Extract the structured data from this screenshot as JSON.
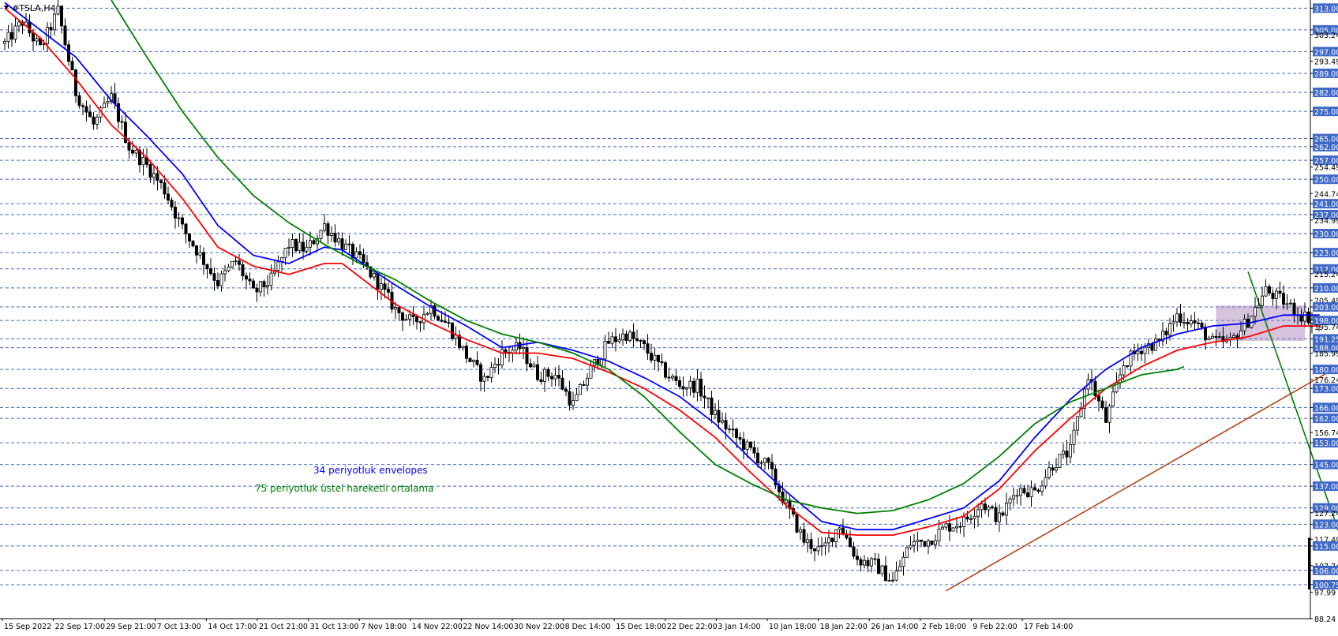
{
  "chart_data": {
    "type": "candlestick",
    "symbol_label": "#TSLA,H4",
    "price_axis": {
      "ylim": [
        88.24,
        316.0
      ],
      "tick_labels": [
        "313.00",
        "305.00",
        "303.24",
        "297.00",
        "293.49",
        "289.00",
        "282.00",
        "275.00",
        "265.00",
        "262.00",
        "257.00",
        "254.49",
        "250.00",
        "244.74",
        "241.00",
        "237.00",
        "234.99",
        "230.00",
        "223.00",
        "217.00",
        "215.24",
        "210.00",
        "205.49",
        "203.00",
        "198.00",
        "195.74",
        "191.25",
        "188.00",
        "185.99",
        "180.00",
        "176.24",
        "173.00",
        "166.00",
        "162.00",
        "156.74",
        "153.00",
        "145.00",
        "137.00",
        "129.00",
        "127.24",
        "123.00",
        "117.49",
        "115.00",
        "107.74",
        "106.00",
        "100.75",
        "97.99",
        "88.24"
      ],
      "level_lines": [
        313,
        305,
        297,
        289,
        282,
        275,
        265,
        262,
        257,
        250,
        241,
        237,
        230,
        223,
        217,
        210,
        203,
        198,
        191.25,
        188,
        180,
        173,
        166,
        162,
        153,
        145,
        137,
        129,
        123,
        115,
        106,
        100.75
      ],
      "highlighted_labels": [
        "313.00",
        "305.00",
        "297.00",
        "289.00",
        "282.00",
        "275.00",
        "265.00",
        "262.00",
        "257.00",
        "250.00",
        "241.00",
        "237.00",
        "230.00",
        "223.00",
        "217.00",
        "210.00",
        "203.00",
        "198.00",
        "191.25",
        "188.00",
        "180.00",
        "173.00",
        "166.00",
        "162.00",
        "153.00",
        "145.00",
        "137.00",
        "129.00",
        "123.00",
        "115.00",
        "106.00",
        "100.75"
      ],
      "label_color": "#4169c8"
    },
    "time_axis": {
      "labels": [
        "15 Sep 2022",
        "22 Sep 17:00",
        "29 Sep 21:00",
        "7 Oct 13:00",
        "14 Oct 17:00",
        "21 Oct 21:00",
        "31 Oct 13:00",
        "7 Nov 18:00",
        "14 Nov 22:00",
        "22 Nov 14:00",
        "30 Nov 22:00",
        "8 Dec 14:00",
        "15 Dec 18:00",
        "22 Dec 22:00",
        "3 Jan 14:00",
        "10 Jan 18:00",
        "18 Jan 22:00",
        "26 Jan 14:00",
        "2 Feb 18:00",
        "9 Feb 22:00",
        "17 Feb 14:00"
      ]
    },
    "price_path": [
      [
        0,
        300
      ],
      [
        5,
        308
      ],
      [
        10,
        298
      ],
      [
        15,
        312
      ],
      [
        20,
        282
      ],
      [
        25,
        270
      ],
      [
        30,
        280
      ],
      [
        35,
        262
      ],
      [
        40,
        255
      ],
      [
        45,
        246
      ],
      [
        50,
        232
      ],
      [
        55,
        222
      ],
      [
        60,
        212
      ],
      [
        65,
        220
      ],
      [
        70,
        208
      ],
      [
        75,
        213
      ],
      [
        80,
        226
      ],
      [
        85,
        224
      ],
      [
        90,
        233
      ],
      [
        95,
        226
      ],
      [
        100,
        220
      ],
      [
        105,
        212
      ],
      [
        110,
        202
      ],
      [
        115,
        197
      ],
      [
        120,
        203
      ],
      [
        125,
        196
      ],
      [
        130,
        185
      ],
      [
        135,
        176
      ],
      [
        140,
        186
      ],
      [
        145,
        188
      ],
      [
        150,
        178
      ],
      [
        155,
        178
      ],
      [
        160,
        167
      ],
      [
        165,
        180
      ],
      [
        170,
        190
      ],
      [
        175,
        193
      ],
      [
        180,
        188
      ],
      [
        185,
        180
      ],
      [
        190,
        174
      ],
      [
        195,
        174
      ],
      [
        200,
        163
      ],
      [
        205,
        156
      ],
      [
        210,
        150
      ],
      [
        215,
        144
      ],
      [
        220,
        130
      ],
      [
        225,
        117
      ],
      [
        230,
        113
      ],
      [
        235,
        123
      ],
      [
        240,
        110
      ],
      [
        245,
        108
      ],
      [
        250,
        102
      ],
      [
        255,
        116
      ],
      [
        260,
        117
      ],
      [
        265,
        122
      ],
      [
        270,
        124
      ],
      [
        275,
        131
      ],
      [
        280,
        125
      ],
      [
        285,
        136
      ],
      [
        290,
        135
      ],
      [
        295,
        145
      ],
      [
        300,
        150
      ],
      [
        305,
        178
      ],
      [
        310,
        161
      ],
      [
        315,
        182
      ],
      [
        320,
        188
      ],
      [
        325,
        190
      ],
      [
        330,
        200
      ],
      [
        335,
        197
      ],
      [
        340,
        190
      ],
      [
        345,
        190
      ],
      [
        350,
        198
      ],
      [
        355,
        209
      ],
      [
        360,
        205
      ],
      [
        365,
        200
      ],
      [
        370,
        198
      ]
    ],
    "series": [
      {
        "name": "34 periyotluk envelopes",
        "color": "#0000ff",
        "values": [
          [
            0,
            315
          ],
          [
            10,
            305
          ],
          [
            20,
            295
          ],
          [
            30,
            279
          ],
          [
            40,
            266
          ],
          [
            50,
            252
          ],
          [
            60,
            233
          ],
          [
            70,
            222
          ],
          [
            80,
            219
          ],
          [
            90,
            225
          ],
          [
            95,
            224
          ],
          [
            110,
            211
          ],
          [
            120,
            203
          ],
          [
            130,
            196
          ],
          [
            140,
            188
          ],
          [
            150,
            190
          ],
          [
            160,
            187
          ],
          [
            170,
            183
          ],
          [
            180,
            177
          ],
          [
            190,
            170
          ],
          [
            200,
            160
          ],
          [
            210,
            147
          ],
          [
            220,
            135
          ],
          [
            230,
            124
          ],
          [
            240,
            121
          ],
          [
            250,
            121
          ],
          [
            260,
            125
          ],
          [
            270,
            129
          ],
          [
            280,
            139
          ],
          [
            290,
            155
          ],
          [
            300,
            169
          ],
          [
            310,
            180
          ],
          [
            320,
            188
          ],
          [
            330,
            193
          ],
          [
            340,
            196
          ],
          [
            350,
            197
          ],
          [
            360,
            200
          ],
          [
            370,
            200
          ]
        ]
      },
      {
        "name": "34 periyotluk envelopes (lower)",
        "color": "#ff0000",
        "values": [
          [
            0,
            313
          ],
          [
            10,
            302
          ],
          [
            20,
            287
          ],
          [
            30,
            270
          ],
          [
            40,
            258
          ],
          [
            50,
            243
          ],
          [
            60,
            225
          ],
          [
            70,
            218
          ],
          [
            80,
            215
          ],
          [
            90,
            219
          ],
          [
            95,
            219
          ],
          [
            110,
            204
          ],
          [
            120,
            197
          ],
          [
            130,
            191
          ],
          [
            140,
            186
          ],
          [
            150,
            186
          ],
          [
            160,
            184
          ],
          [
            170,
            179
          ],
          [
            180,
            173
          ],
          [
            190,
            165
          ],
          [
            200,
            155
          ],
          [
            210,
            142
          ],
          [
            220,
            130
          ],
          [
            230,
            120
          ],
          [
            240,
            119
          ],
          [
            250,
            119
          ],
          [
            260,
            122
          ],
          [
            270,
            126
          ],
          [
            280,
            136
          ],
          [
            290,
            150
          ],
          [
            300,
            162
          ],
          [
            310,
            173
          ],
          [
            320,
            181
          ],
          [
            330,
            187
          ],
          [
            340,
            190
          ],
          [
            350,
            192
          ],
          [
            360,
            196
          ],
          [
            370,
            196
          ]
        ]
      },
      {
        "name": "75 periyotluk üstel hareketli ortalama",
        "color": "#008000",
        "values": [
          [
            30,
            316
          ],
          [
            40,
            295
          ],
          [
            50,
            275
          ],
          [
            60,
            258
          ],
          [
            70,
            244
          ],
          [
            80,
            234
          ],
          [
            90,
            226
          ],
          [
            100,
            219
          ],
          [
            110,
            213
          ],
          [
            120,
            205
          ],
          [
            130,
            198
          ],
          [
            140,
            193
          ],
          [
            150,
            190
          ],
          [
            160,
            186
          ],
          [
            170,
            180
          ],
          [
            180,
            170
          ],
          [
            190,
            157
          ],
          [
            200,
            145
          ],
          [
            210,
            138
          ],
          [
            220,
            132
          ],
          [
            230,
            129
          ],
          [
            240,
            127
          ],
          [
            250,
            128
          ],
          [
            260,
            132
          ],
          [
            270,
            138
          ],
          [
            280,
            148
          ],
          [
            290,
            160
          ],
          [
            300,
            168
          ],
          [
            310,
            173
          ],
          [
            320,
            178
          ],
          [
            330,
            180
          ],
          [
            332,
            181
          ]
        ]
      }
    ],
    "support_line": {
      "color": "#b5451b",
      "from": [
        265,
        98.5
      ],
      "to": [
        372,
        178.5
      ]
    },
    "resistance_line": {
      "color": "#008000",
      "from": [
        350,
        216
      ],
      "to": [
        384,
        88.5
      ]
    },
    "highlight_box": {
      "color": "#a37bb3",
      "x_from": [
        341,
        366
      ],
      "y_range": [
        190.5,
        203.5
      ]
    },
    "annotations": [
      {
        "text": "34 periyotluk envelopes",
        "color": "#0000ff"
      },
      {
        "text": "75 periyotluk üstel hareketli ortalama",
        "color": "#008000"
      }
    ],
    "current_price_bar": {
      "from": 99,
      "to": 118,
      "color": "#000000"
    }
  }
}
